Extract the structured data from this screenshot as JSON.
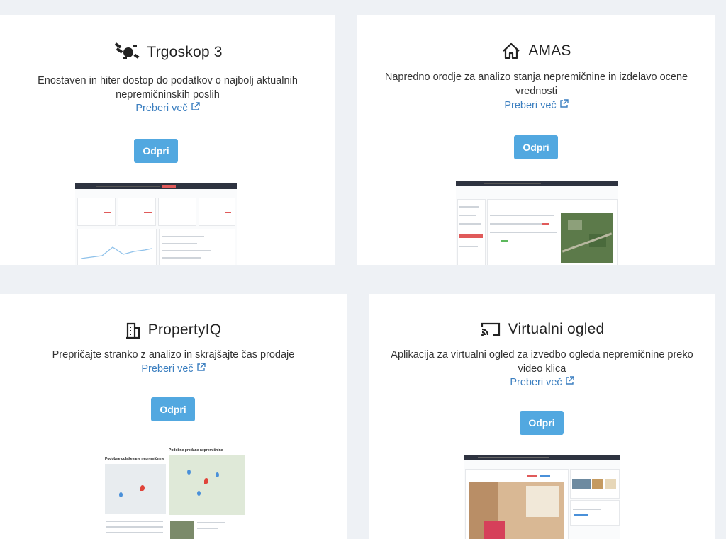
{
  "cards": [
    {
      "title": "Trgoskop 3",
      "icon": "satellite-icon",
      "description": "Enostaven in hiter dostop do podatkov o najbolj aktualnih nepremičninskih poslih",
      "more_label": "Preberi več",
      "button_label": "Odpri"
    },
    {
      "title": "AMAS",
      "icon": "home-icon",
      "description": "Napredno orodje za analizo stanja nepremičnine in izdelavo ocene vrednosti",
      "more_label": "Preberi več",
      "button_label": "Odpri"
    },
    {
      "title": "PropertyIQ",
      "icon": "building-icon",
      "description": "Prepričajte stranko z analizo in skrajšajte čas prodaje",
      "more_label": "Preberi več",
      "button_label": "Odpri",
      "preview_texts": [
        "Podobne oglaševane nepremičnine",
        "Podobne prodane nepremičnine"
      ]
    },
    {
      "title": "Virtualni ogled",
      "icon": "cast-icon",
      "description": "Aplikacija za virtualni ogled za izvedbo ogleda nepremičnine preko video klica",
      "more_label": "Preberi več",
      "button_label": "Odpri"
    }
  ],
  "colors": {
    "accent": "#52a8e0",
    "link": "#3c7fc0",
    "background": "#eef1f5"
  }
}
